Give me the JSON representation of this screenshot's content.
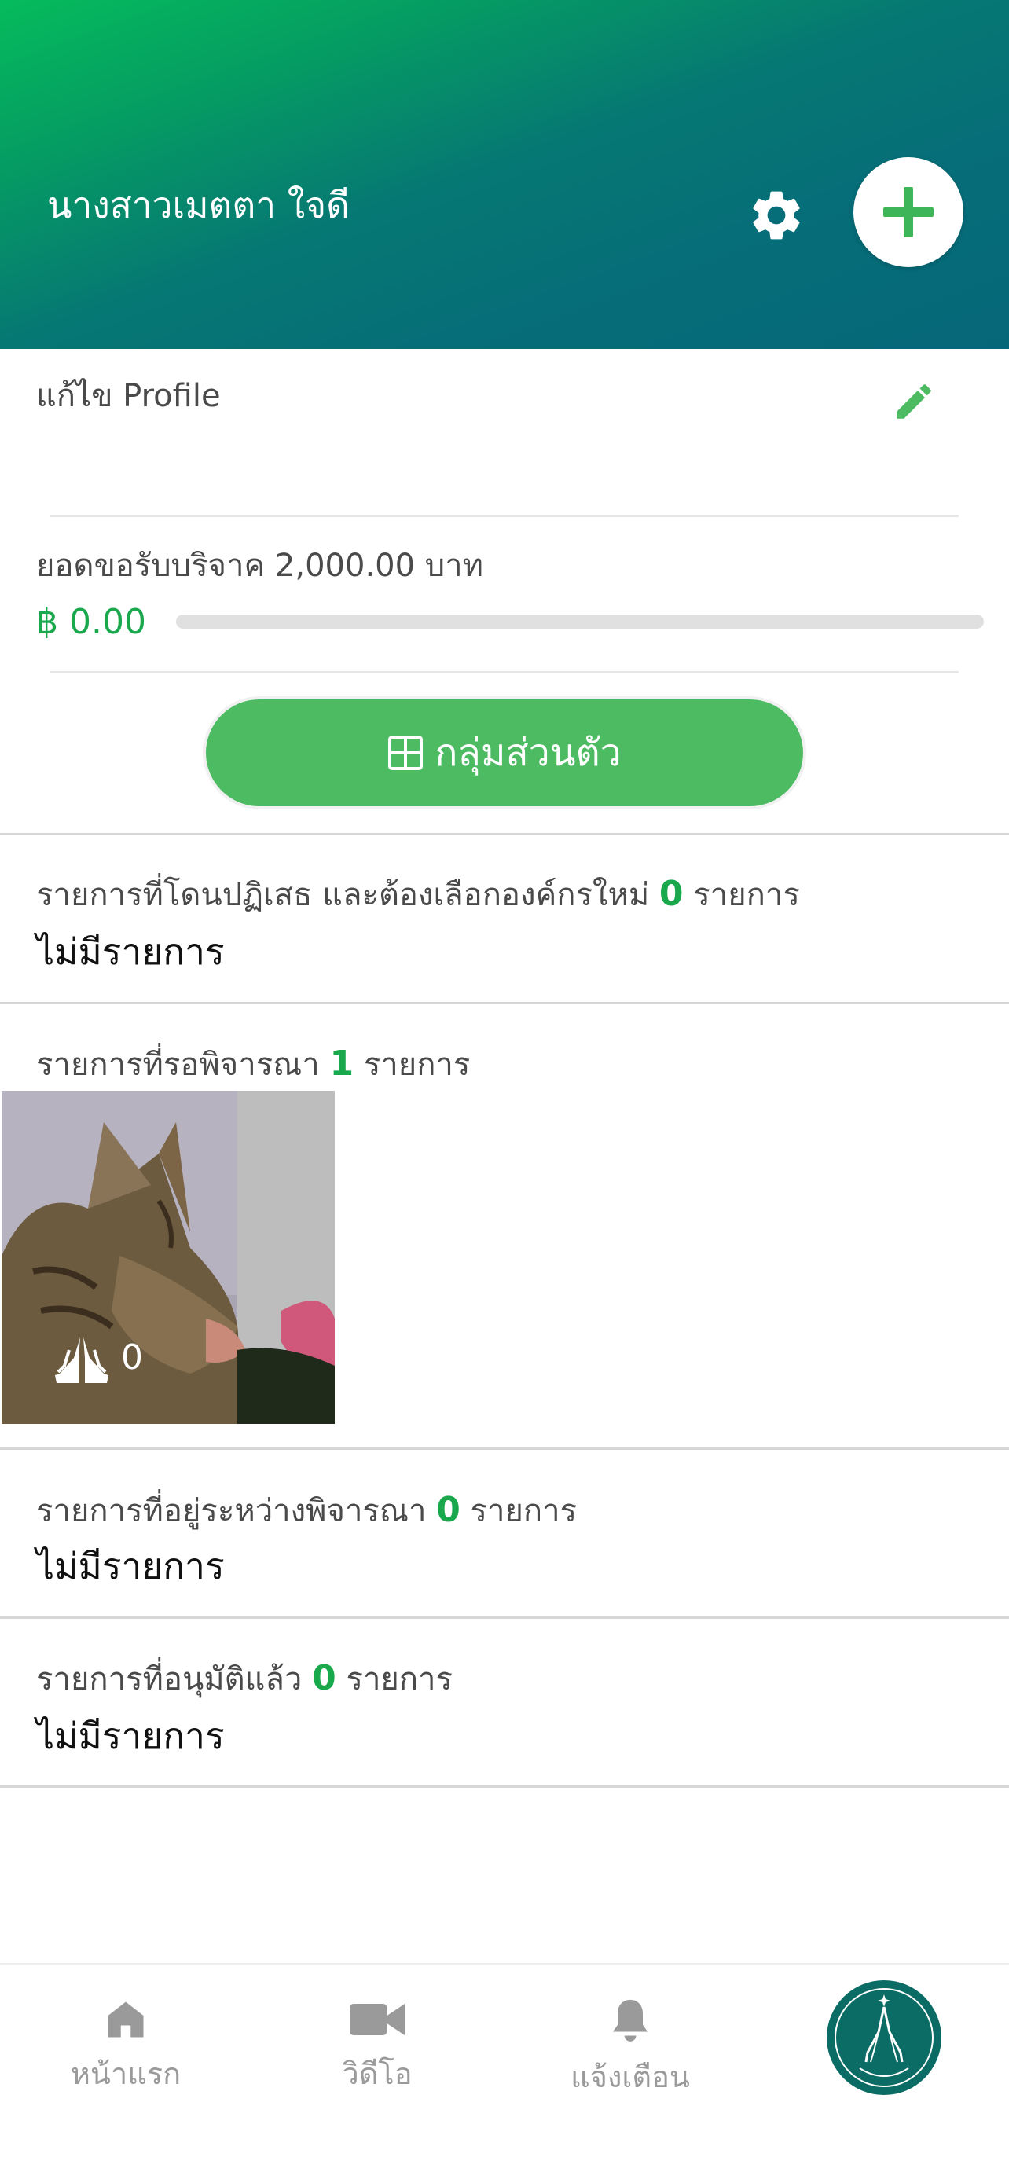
{
  "header": {
    "user_name": "นางสาวเมตตา ใจดี",
    "settings_icon": "gear-icon",
    "add_icon": "plus-icon"
  },
  "profile": {
    "edit_label": "แก้ไข Profile",
    "edit_icon": "pencil-icon"
  },
  "donation": {
    "goal_text": "ยอดขอรับบริจาค 2,000.00 บาท",
    "amount": "฿ 0.00",
    "progress_fraction": 0
  },
  "group_button": {
    "label": "กลุ่มส่วนตัว",
    "icon": "grid-icon"
  },
  "sections": {
    "rejected": {
      "title_prefix": "รายการที่โดนปฏิเสธ และต้องเลือกองค์กรใหม่",
      "count": "0",
      "title_suffix": "รายการ",
      "empty_text": "ไม่มีรายการ"
    },
    "pending": {
      "title_prefix": "รายการที่รอพิจารณา",
      "count": "1",
      "title_suffix": "รายการ",
      "item": {
        "pray_icon": "praying-hands-icon",
        "pray_count": "0"
      }
    },
    "in_review": {
      "title_prefix": "รายการที่อยู่ระหว่างพิจารณา",
      "count": "0",
      "title_suffix": "รายการ",
      "empty_text": "ไม่มีรายการ"
    },
    "approved": {
      "title_prefix": "รายการที่อนุมัติแล้ว",
      "count": "0",
      "title_suffix": "รายการ",
      "empty_text": "ไม่มีรายการ"
    }
  },
  "bottom_nav": {
    "items": [
      {
        "label": "หน้าแรก",
        "icon": "home-icon"
      },
      {
        "label": "วิดีโอ",
        "icon": "video-camera-icon"
      },
      {
        "label": "แจ้งเตือน",
        "icon": "bell-icon"
      }
    ],
    "logo_icon": "app-logo-icon"
  },
  "colors": {
    "accent_green": "#1aa84d",
    "button_green": "#4cbb62",
    "header_start": "#05bb5c",
    "header_end": "#066778",
    "nav_gray": "#9a9a9a"
  }
}
